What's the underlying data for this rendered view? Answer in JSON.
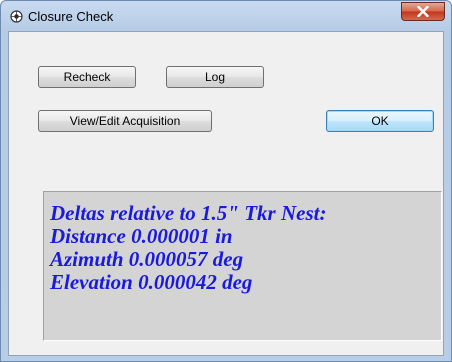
{
  "window": {
    "title": "Closure Check",
    "close_glyph": "x"
  },
  "buttons": {
    "recheck": "Recheck",
    "log": "Log",
    "view_edit": "View/Edit Acquisition",
    "ok": "OK"
  },
  "results": {
    "lines": [
      "Deltas relative to 1.5\" Tkr Nest:",
      "Distance  0.000001 in",
      "Azimuth 0.000057 deg",
      "Elevation 0.000042 deg"
    ]
  },
  "colors": {
    "results_text": "#1a1adc",
    "results_background": "#d4d4d4",
    "close_button": "#c2341b"
  },
  "icons": {
    "app": "app-icon",
    "close": "close-icon"
  }
}
